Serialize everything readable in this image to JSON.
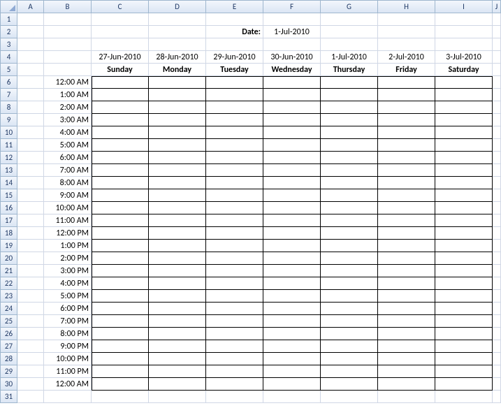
{
  "columns": [
    "A",
    "B",
    "C",
    "D",
    "E",
    "F",
    "G",
    "H",
    "I",
    "J"
  ],
  "rowCount": 31,
  "labels": {
    "dateLabel": "Date:",
    "dateValue": "1-Jul-2010"
  },
  "dayHeaders": [
    {
      "date": "27-Jun-2010",
      "day": "Sunday"
    },
    {
      "date": "28-Jun-2010",
      "day": "Monday"
    },
    {
      "date": "29-Jun-2010",
      "day": "Tuesday"
    },
    {
      "date": "30-Jun-2010",
      "day": "Wednesday"
    },
    {
      "date": "1-Jul-2010",
      "day": "Thursday"
    },
    {
      "date": "2-Jul-2010",
      "day": "Friday"
    },
    {
      "date": "3-Jul-2010",
      "day": "Saturday"
    }
  ],
  "timeSlots": [
    "12:00 AM",
    "1:00 AM",
    "2:00 AM",
    "3:00 AM",
    "4:00 AM",
    "5:00 AM",
    "6:00 AM",
    "7:00 AM",
    "8:00 AM",
    "9:00 AM",
    "10:00 AM",
    "11:00 AM",
    "12:00 PM",
    "1:00 PM",
    "2:00 PM",
    "3:00 PM",
    "4:00 PM",
    "5:00 PM",
    "6:00 PM",
    "7:00 PM",
    "8:00 PM",
    "9:00 PM",
    "10:00 PM",
    "11:00 PM",
    "12:00 AM"
  ]
}
